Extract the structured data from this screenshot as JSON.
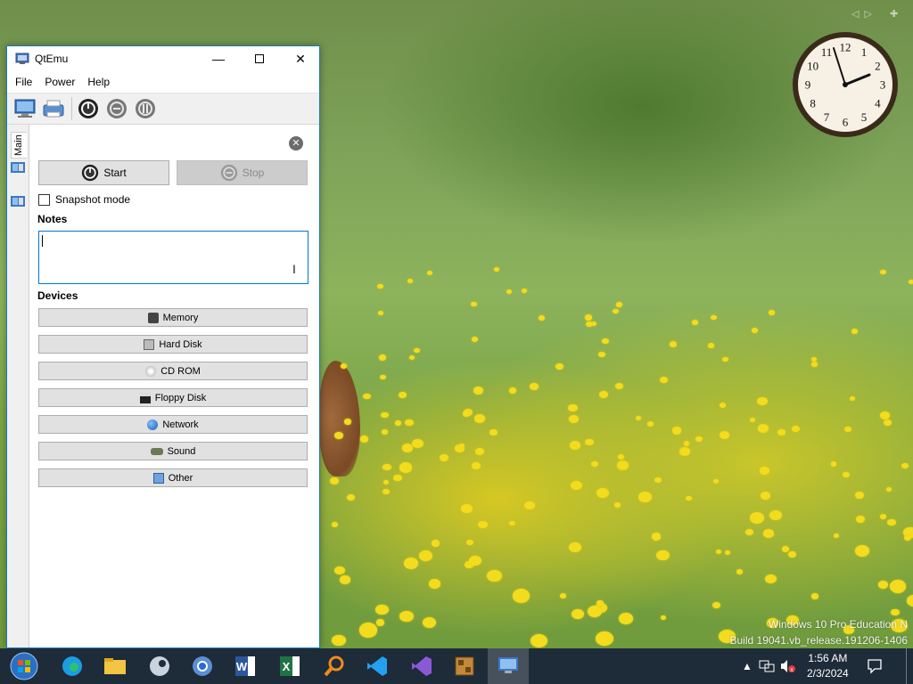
{
  "window": {
    "title": "QtEmu",
    "minimize_icon": "minimize-icon",
    "maximize_icon": "maximize-icon",
    "close_icon": "close-icon"
  },
  "menu": [
    "File",
    "Power",
    "Help"
  ],
  "toolbar": {
    "icons": [
      "machine-icon",
      "printer-icon",
      "power-on-icon",
      "shutdown-icon",
      "reset-icon"
    ]
  },
  "side_tabs": {
    "main_label": "Main"
  },
  "panel": {
    "start_label": "Start",
    "stop_label": "Stop",
    "snapshot_label": "Snapshot mode",
    "snapshot_checked": false,
    "notes_label": "Notes",
    "notes_value": "",
    "devices_label": "Devices"
  },
  "devices": [
    {
      "label": "Memory",
      "icon": "memory-icon"
    },
    {
      "label": "Hard Disk",
      "icon": "hard-disk-icon"
    },
    {
      "label": "CD ROM",
      "icon": "cd-rom-icon"
    },
    {
      "label": "Floppy Disk",
      "icon": "floppy-disk-icon"
    },
    {
      "label": "Network",
      "icon": "network-icon"
    },
    {
      "label": "Sound",
      "icon": "sound-icon"
    },
    {
      "label": "Other",
      "icon": "other-icon"
    }
  ],
  "desktop": {
    "watermark_line1": "Windows 10 Pro Education N",
    "watermark_line2": "Build 19041.vb_release.191206-1406",
    "clock_gadget_numbers": [
      "12",
      "1",
      "2",
      "3",
      "4",
      "5",
      "6",
      "7",
      "8",
      "9",
      "10",
      "11"
    ]
  },
  "taskbar": {
    "apps": [
      "start-orb-icon",
      "edge-icon",
      "file-explorer-icon",
      "steam-icon",
      "chrome-icon",
      "word-icon",
      "excel-icon",
      "search-tool-icon",
      "vscode-icon",
      "visual-studio-icon",
      "archive-icon",
      "qtemu-icon"
    ],
    "time": "1:56 AM",
    "date": "2/3/2024"
  },
  "colors": {
    "accent": "#0078d7",
    "taskbar": "#1e2b39",
    "window_border": "#1979ca"
  }
}
